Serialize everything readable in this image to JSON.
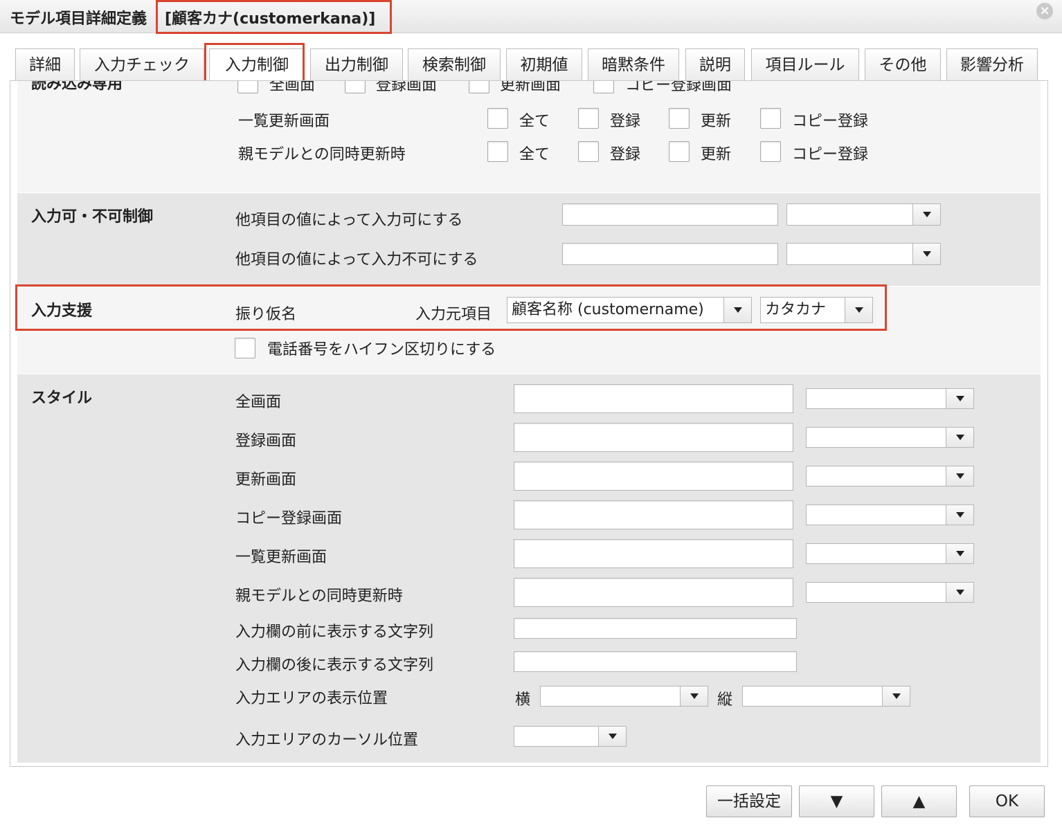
{
  "window": {
    "title": "モデル項目詳細定義",
    "item_name": "[顧客カナ(customerkana)]",
    "close_label": "×"
  },
  "tabs": [
    {
      "label": "詳細"
    },
    {
      "label": "入力チェック"
    },
    {
      "label": "入力制御",
      "active": true
    },
    {
      "label": "出力制御"
    },
    {
      "label": "検索制御"
    },
    {
      "label": "初期値"
    },
    {
      "label": "暗黙条件"
    },
    {
      "label": "説明"
    },
    {
      "label": "項目ルール"
    },
    {
      "label": "その他"
    },
    {
      "label": "影響分析"
    }
  ],
  "readonly_section": {
    "title_partial": "読み込み専用",
    "top_row": [
      "全画面",
      "登録画面",
      "更新画面",
      "コピー登録画面"
    ],
    "rows": [
      {
        "label": "一覧更新画面",
        "options": [
          "全て",
          "登録",
          "更新",
          "コピー登録"
        ]
      },
      {
        "label": "親モデルとの同時更新時",
        "options": [
          "全て",
          "登録",
          "更新",
          "コピー登録"
        ]
      }
    ]
  },
  "input_enable_section": {
    "title": "入力可・不可制御",
    "rows": [
      {
        "label": "他項目の値によって入力可にする",
        "value": "",
        "select": ""
      },
      {
        "label": "他項目の値によって入力不可にする",
        "value": "",
        "select": ""
      }
    ]
  },
  "input_support_section": {
    "title": "入力支援",
    "furigana_label": "振り仮名",
    "source_label": "入力元項目",
    "source_value": "顧客名称 (customername)",
    "kana_type": "カタカナ",
    "phone_label": "電話番号をハイフン区切りにする"
  },
  "style_section": {
    "title": "スタイル",
    "rows": [
      {
        "label": "全画面"
      },
      {
        "label": "登録画面"
      },
      {
        "label": "更新画面"
      },
      {
        "label": "コピー登録画面"
      },
      {
        "label": "一覧更新画面"
      },
      {
        "label": "親モデルとの同時更新時"
      }
    ],
    "prefix_label": "入力欄の前に表示する文字列",
    "suffix_label": "入力欄の後に表示する文字列",
    "position_label": "入力エリアの表示位置",
    "horizontal_label": "横",
    "vertical_label": "縦",
    "cursor_label": "入力エリアのカーソル位置"
  },
  "buttons": {
    "bulk": "一括設定",
    "down": "▼",
    "up": "▲",
    "ok": "OK"
  }
}
